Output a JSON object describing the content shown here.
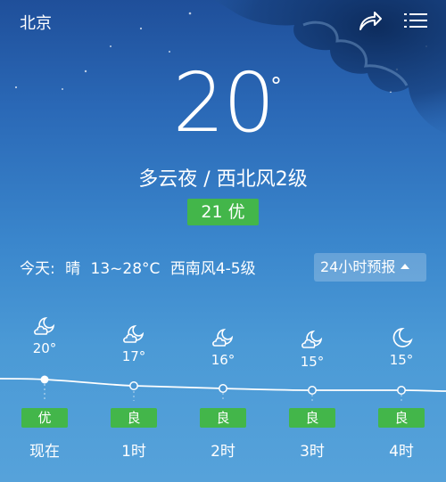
{
  "header": {
    "city": "北京"
  },
  "current": {
    "temperature": "20",
    "degree_symbol": "°",
    "condition": "多云夜 / 西北风2级",
    "aqi": "21 优"
  },
  "today": {
    "label": "今天:",
    "weather": "晴",
    "range": "13~28°C",
    "wind": "西南风4-5级"
  },
  "hourly_button": {
    "label": "24小时预报"
  },
  "hourly": [
    {
      "temp": "20°",
      "aqi": "优",
      "time": "现在",
      "icon": "partly-cloudy-night-icon"
    },
    {
      "temp": "17°",
      "aqi": "良",
      "time": "1时",
      "icon": "partly-cloudy-night-icon"
    },
    {
      "temp": "16°",
      "aqi": "良",
      "time": "2时",
      "icon": "partly-cloudy-night-icon"
    },
    {
      "temp": "15°",
      "aqi": "良",
      "time": "3时",
      "icon": "partly-cloudy-night-icon"
    },
    {
      "temp": "15°",
      "aqi": "良",
      "time": "4时",
      "icon": "moon-icon"
    }
  ],
  "colors": {
    "aqi_good": "#43b64a",
    "bg_top": "#1f4f9a",
    "bg_bottom": "#56a2da"
  }
}
